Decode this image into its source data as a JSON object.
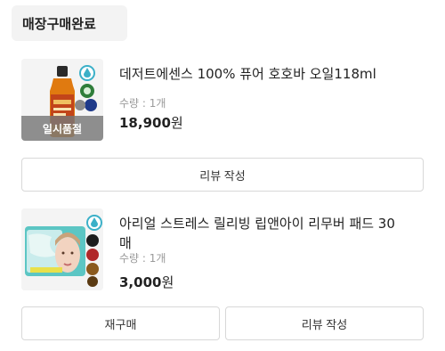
{
  "section": {
    "title": "매장구매완료"
  },
  "orders": [
    {
      "name": "데저트에센스 100% 퓨어 호호바 오일118ml",
      "quantity": "수량 : 1개",
      "price": "18,900",
      "currency": "원",
      "badge": "일시품절",
      "thumb_icon": "oil-bottle-icon",
      "buttons": {
        "review": "리뷰 작성"
      }
    },
    {
      "name": "아리얼 스트레스 릴리빙 립앤아이 리무버 패드 30매",
      "quantity": "수량 : 1개",
      "price": "3,000",
      "currency": "원",
      "thumb_icon": "remover-pad-icon",
      "buttons": {
        "rebuy": "재구매",
        "review": "리뷰 작성"
      }
    }
  ],
  "colors": {
    "header_bg": "#f3f3f3",
    "border": "#d8d8d8",
    "muted_text": "#9a9a9a",
    "soldout_overlay": "#787878"
  }
}
